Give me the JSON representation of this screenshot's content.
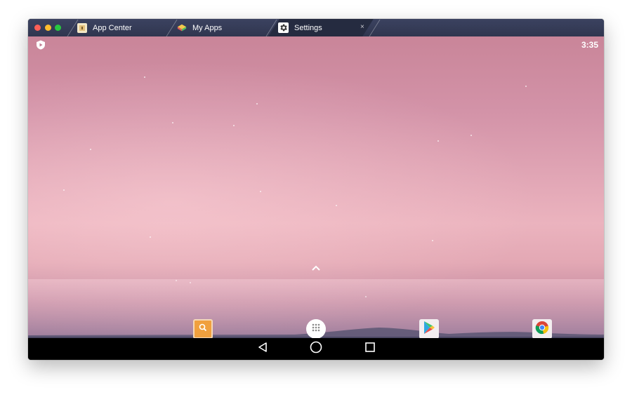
{
  "window": {
    "tabs": [
      {
        "label": "App Center",
        "icon": "app-center-icon"
      },
      {
        "label": "My Apps",
        "icon": "my-apps-icon"
      },
      {
        "label": "Settings",
        "icon": "gear-icon",
        "active": true,
        "close_glyph": "×"
      }
    ],
    "colors": {
      "titlebar": "#343a55",
      "active_tab": "#252b40",
      "traffic_close": "#fe5f57",
      "traffic_minimize": "#febc2e",
      "traffic_maximize": "#28c840"
    }
  },
  "status_bar": {
    "time": "3:35",
    "left_icon": "shield-play-icon"
  },
  "home_screen": {
    "swipe_up_icon": "chevron-up-icon",
    "dock_apps": [
      {
        "name": "Search",
        "icon": "search-icon",
        "color": "#f0a03e"
      },
      {
        "name": "All apps",
        "icon": "app-drawer-icon"
      },
      {
        "name": "Play Store",
        "icon": "play-store-icon"
      },
      {
        "name": "Chrome",
        "icon": "chrome-icon"
      }
    ],
    "wallpaper_colors": [
      "#c98599",
      "#ebb3be",
      "#9a7c9b"
    ]
  },
  "nav_bar": {
    "buttons": [
      {
        "name": "Back",
        "icon": "back-triangle-icon"
      },
      {
        "name": "Home",
        "icon": "home-circle-icon"
      },
      {
        "name": "Recents",
        "icon": "recents-square-icon"
      }
    ]
  }
}
